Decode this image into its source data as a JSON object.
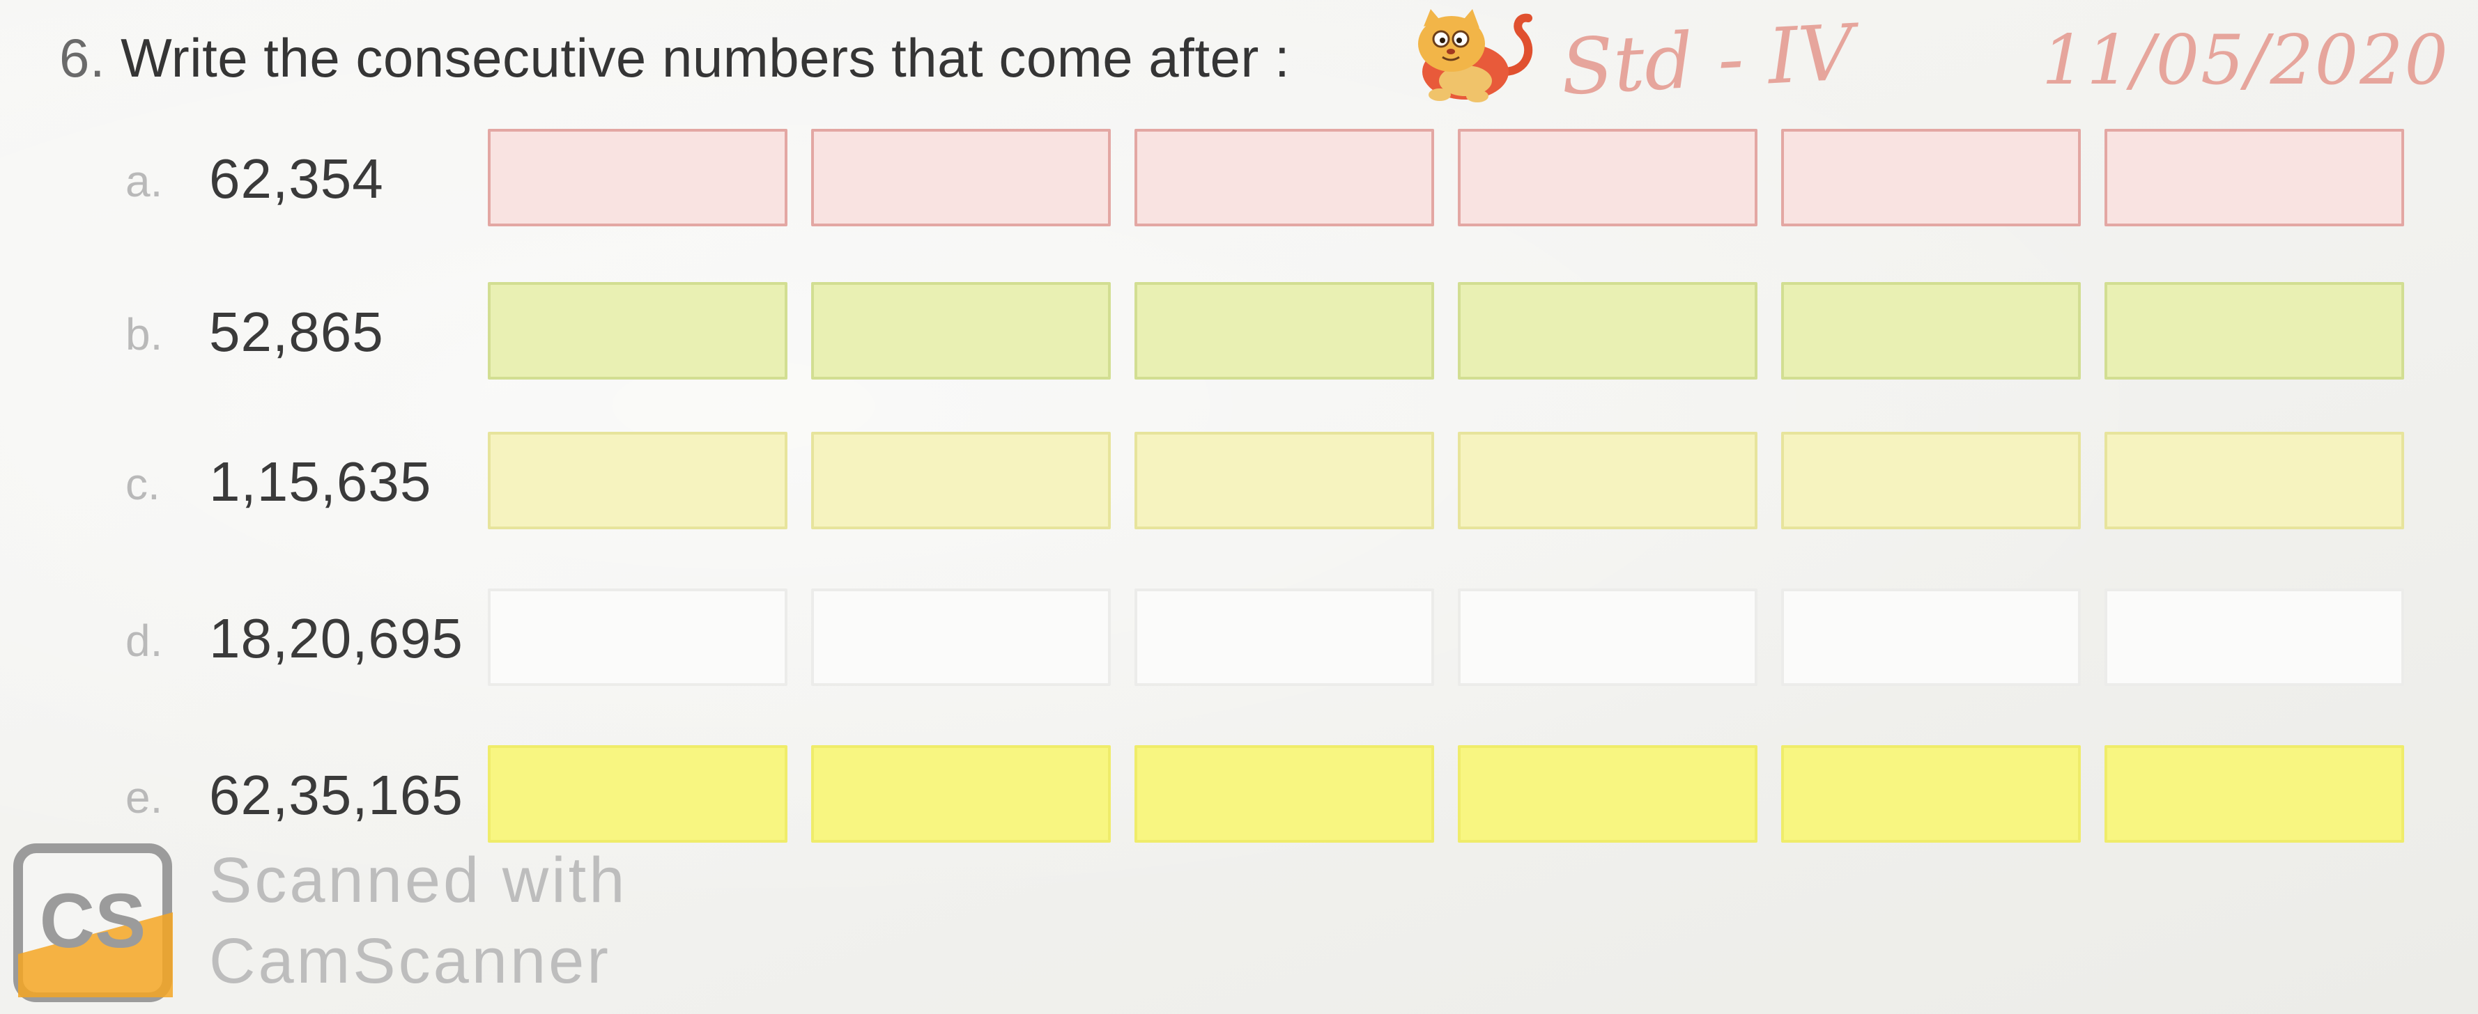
{
  "question": {
    "number": "6.",
    "text": "Write the consecutive numbers that come after :"
  },
  "mascot": {
    "icon": "cat-icon"
  },
  "handwriting": {
    "std": "Std - IV",
    "date": "11/05/2020"
  },
  "rows": [
    {
      "letter": "a.",
      "number": "62,354",
      "box_fill": "#f9e3e1",
      "box_border": "#e3a7a3"
    },
    {
      "letter": "b.",
      "number": "52,865",
      "box_fill": "#e9f0b3",
      "box_border": "#d2de92"
    },
    {
      "letter": "c.",
      "number": "1,15,635",
      "box_fill": "#f6f3bf",
      "box_border": "#e7e49c"
    },
    {
      "letter": "d.",
      "number": "18,20,695",
      "box_fill": "#fbfbfa",
      "box_border": "#ececea"
    },
    {
      "letter": "e.",
      "number": "62,35,165",
      "box_fill": "#f8f681",
      "box_border": "#efec6a"
    }
  ],
  "boxes_per_row": 6,
  "watermark": {
    "logo_text": "CS",
    "line1": "Scanned with",
    "line2": "CamScanner"
  }
}
